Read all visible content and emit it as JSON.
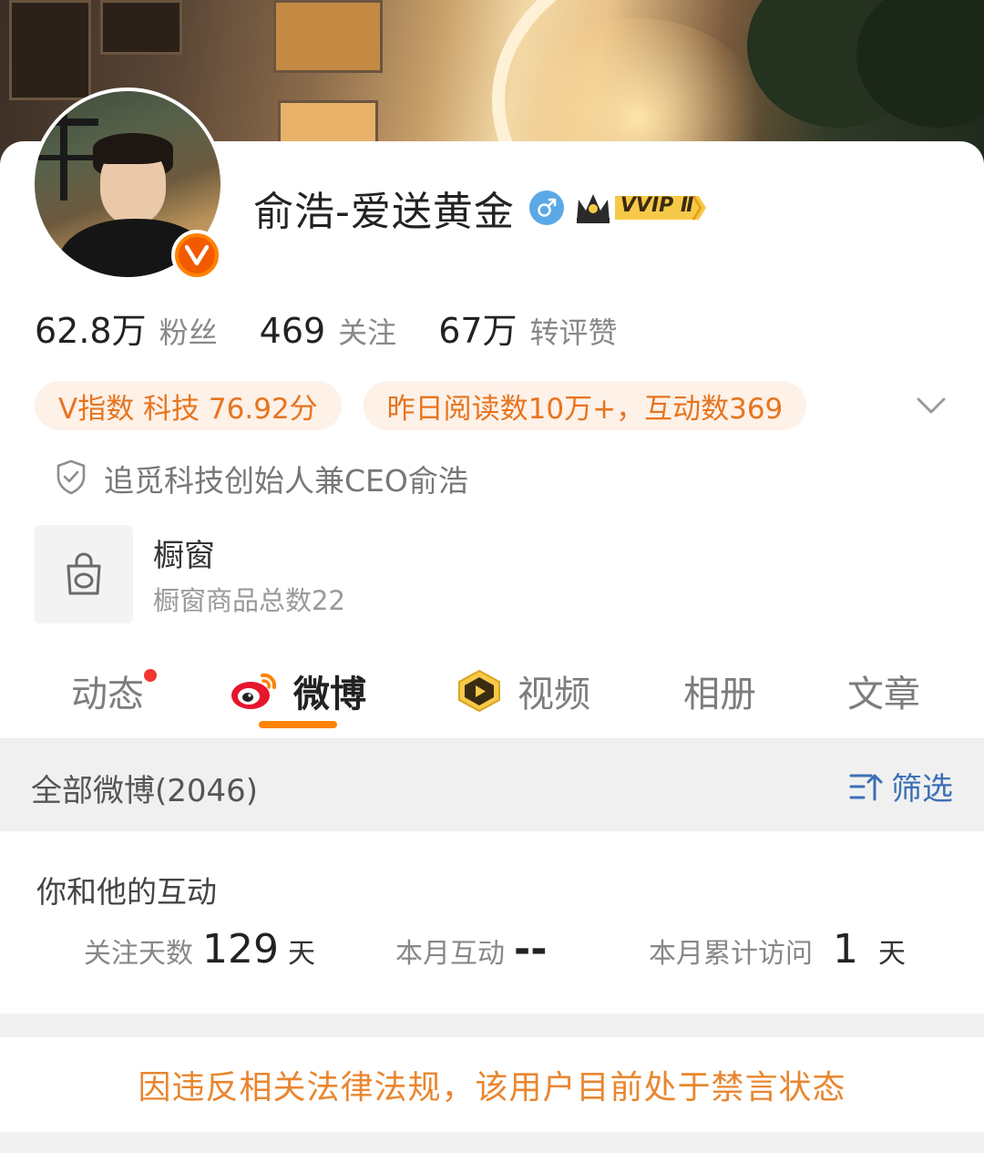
{
  "profile": {
    "name": "俞浩-爱送黄金",
    "vip_label": "VVIP Ⅱ",
    "gender_symbol": "♂",
    "verified_badge": "V"
  },
  "stats": [
    {
      "num": "62.8万",
      "label": "粉丝"
    },
    {
      "num": "469",
      "label": "关注"
    },
    {
      "num": "67万",
      "label": "转评赞"
    }
  ],
  "tags": [
    "V指数 科技 76.92分",
    "昨日阅读数10万+，互动数369"
  ],
  "verification": "追觅科技创始人兼CEO俞浩",
  "shop": {
    "title": "橱窗",
    "subtitle": "橱窗商品总数22"
  },
  "tabs": [
    {
      "label": "动态",
      "active": false,
      "has_dot": true
    },
    {
      "label": "微博",
      "active": true
    },
    {
      "label": "视频",
      "active": false
    },
    {
      "label": "相册",
      "active": false
    },
    {
      "label": "文章",
      "active": false
    }
  ],
  "feed_header": {
    "all_label": "全部微博(2046)",
    "filter_label": "筛选"
  },
  "interaction": {
    "title": "你和他的互动",
    "follow_days_label": "关注天数",
    "follow_days_value": "129",
    "follow_days_unit": "天",
    "month_interact_label": "本月互动",
    "month_interact_value": "--",
    "month_visit_label": "本月累计访问",
    "month_visit_value": "1",
    "month_visit_unit": "天"
  },
  "ban_notice": "因违反相关法律法规，该用户目前处于禁言状态",
  "colors": {
    "accent_orange": "#ff8200",
    "tag_text": "#e7741e",
    "tag_bg": "#fdf1e8",
    "link_blue": "#3b6fb6",
    "ban_text": "#e9862f"
  }
}
